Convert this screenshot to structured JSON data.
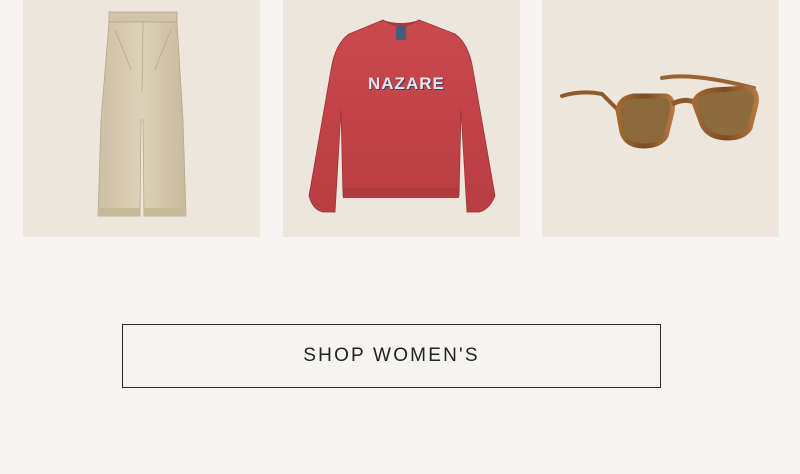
{
  "products": [
    {
      "name": "pants-product-image",
      "icon": "trousers"
    },
    {
      "name": "sweatshirt-product-image",
      "icon": "sweatshirt",
      "print_text": "NAZARE"
    },
    {
      "name": "sunglasses-product-image",
      "icon": "sunglasses"
    }
  ],
  "cta": {
    "label": "SHOP WOMEN'S"
  },
  "colors": {
    "page_bg": "#f6f4f1",
    "tile_bg": "#ece6dc",
    "pants": "#d9ccb3",
    "sweatshirt": "#c4464a",
    "sunglasses_frame": "#9a5a2a",
    "lens": "#8a6a3a",
    "button_border": "#2a2a2a"
  }
}
